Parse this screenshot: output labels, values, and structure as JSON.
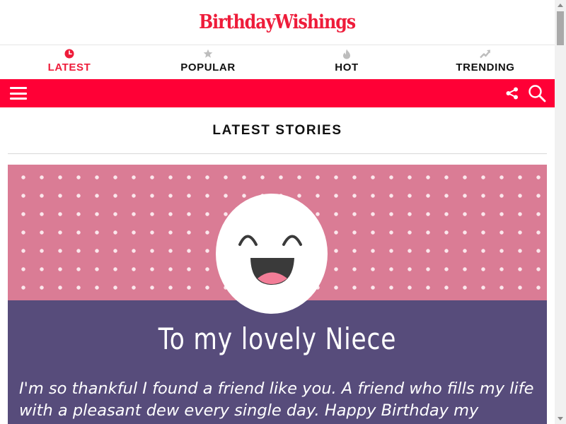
{
  "header": {
    "logo_text": "BirthdayWishings"
  },
  "tabs": [
    {
      "label": "LATEST",
      "icon": "clock-icon",
      "active": true
    },
    {
      "label": "POPULAR",
      "icon": "star-icon",
      "active": false
    },
    {
      "label": "HOT",
      "icon": "flame-icon",
      "active": false
    },
    {
      "label": "TRENDING",
      "icon": "trending-arrow-icon",
      "active": false
    }
  ],
  "toolbar": {
    "menu_icon": "hamburger-icon",
    "share_icon": "share-icon",
    "search_icon": "search-icon"
  },
  "section": {
    "title": "LATEST STORIES"
  },
  "featured": {
    "image_title": "To my lovely Niece",
    "image_text": "I'm so thankful I found a friend like you. A friend who fills my life with a pleasant dew every single day. Happy Birthday my"
  },
  "colors": {
    "brand_red": "#ee1c3a",
    "bar_red": "#ff0036",
    "card_pink": "#da7c95",
    "card_purple": "#574c7b",
    "icon_gray": "#bdbdbd"
  }
}
